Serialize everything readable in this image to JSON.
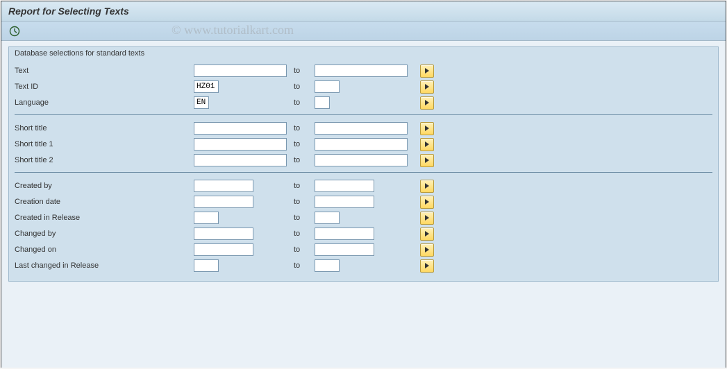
{
  "title": "Report for Selecting Texts",
  "watermark": "© www.tutorialkart.com",
  "group_title": "Database selections for standard texts",
  "to_label": "to",
  "fields": {
    "text": {
      "label": "Text",
      "from": "",
      "to": "",
      "from_w": "w-long",
      "to_w": "w-long"
    },
    "textid": {
      "label": "Text ID",
      "from": "HZ01",
      "to": "",
      "from_w": "w-small",
      "to_w": "w-small"
    },
    "lang": {
      "label": "Language",
      "from": "EN",
      "to": "",
      "from_w": "w-xs",
      "to_w": "w-xs"
    },
    "stitle": {
      "label": "Short title",
      "from": "",
      "to": "",
      "from_w": "w-long",
      "to_w": "w-long"
    },
    "stitle1": {
      "label": "Short title 1",
      "from": "",
      "to": "",
      "from_w": "w-long",
      "to_w": "w-long"
    },
    "stitle2": {
      "label": "Short title 2",
      "from": "",
      "to": "",
      "from_w": "w-long",
      "to_w": "w-long"
    },
    "crby": {
      "label": "Created by",
      "from": "",
      "to": "",
      "from_w": "w-med",
      "to_w": "w-med"
    },
    "crdate": {
      "label": "Creation date",
      "from": "",
      "to": "",
      "from_w": "w-med",
      "to_w": "w-med"
    },
    "crrel": {
      "label": "Created in Release",
      "from": "",
      "to": "",
      "from_w": "w-small",
      "to_w": "w-small"
    },
    "chby": {
      "label": "Changed by",
      "from": "",
      "to": "",
      "from_w": "w-med",
      "to_w": "w-med"
    },
    "chon": {
      "label": "Changed on",
      "from": "",
      "to": "",
      "from_w": "w-med",
      "to_w": "w-med"
    },
    "chrel": {
      "label": "Last changed in Release",
      "from": "",
      "to": "",
      "from_w": "w-small",
      "to_w": "w-small"
    }
  }
}
